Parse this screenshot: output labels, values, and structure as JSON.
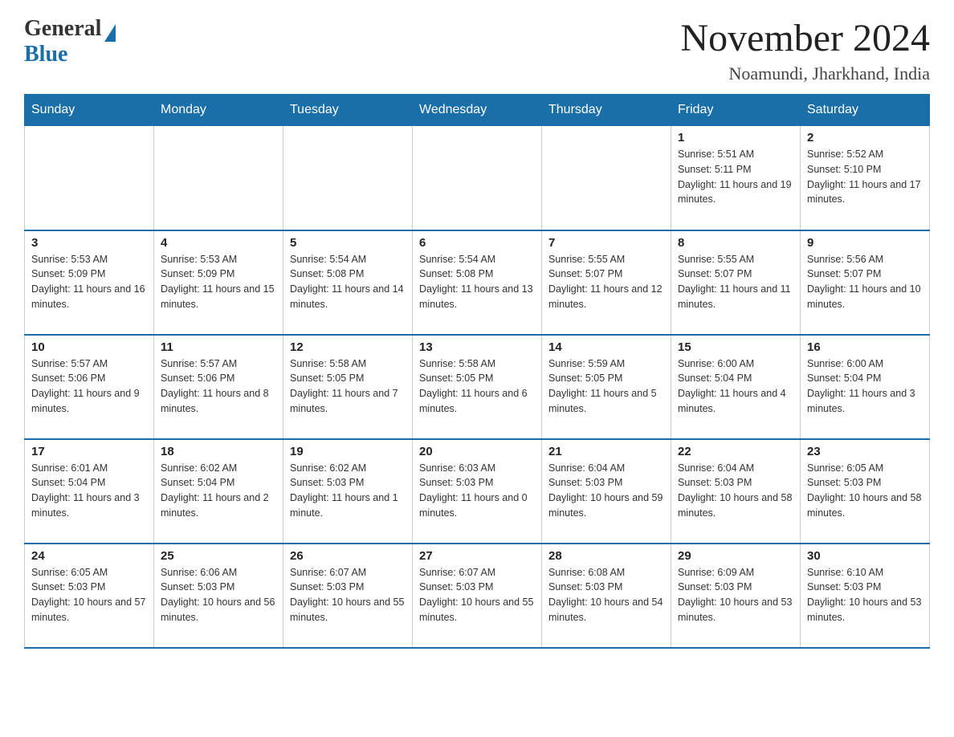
{
  "logo": {
    "general": "General",
    "blue": "Blue"
  },
  "title": "November 2024",
  "subtitle": "Noamundi, Jharkhand, India",
  "weekdays": [
    "Sunday",
    "Monday",
    "Tuesday",
    "Wednesday",
    "Thursday",
    "Friday",
    "Saturday"
  ],
  "weeks": [
    [
      {
        "day": "",
        "info": ""
      },
      {
        "day": "",
        "info": ""
      },
      {
        "day": "",
        "info": ""
      },
      {
        "day": "",
        "info": ""
      },
      {
        "day": "",
        "info": ""
      },
      {
        "day": "1",
        "info": "Sunrise: 5:51 AM\nSunset: 5:11 PM\nDaylight: 11 hours and 19 minutes."
      },
      {
        "day": "2",
        "info": "Sunrise: 5:52 AM\nSunset: 5:10 PM\nDaylight: 11 hours and 17 minutes."
      }
    ],
    [
      {
        "day": "3",
        "info": "Sunrise: 5:53 AM\nSunset: 5:09 PM\nDaylight: 11 hours and 16 minutes."
      },
      {
        "day": "4",
        "info": "Sunrise: 5:53 AM\nSunset: 5:09 PM\nDaylight: 11 hours and 15 minutes."
      },
      {
        "day": "5",
        "info": "Sunrise: 5:54 AM\nSunset: 5:08 PM\nDaylight: 11 hours and 14 minutes."
      },
      {
        "day": "6",
        "info": "Sunrise: 5:54 AM\nSunset: 5:08 PM\nDaylight: 11 hours and 13 minutes."
      },
      {
        "day": "7",
        "info": "Sunrise: 5:55 AM\nSunset: 5:07 PM\nDaylight: 11 hours and 12 minutes."
      },
      {
        "day": "8",
        "info": "Sunrise: 5:55 AM\nSunset: 5:07 PM\nDaylight: 11 hours and 11 minutes."
      },
      {
        "day": "9",
        "info": "Sunrise: 5:56 AM\nSunset: 5:07 PM\nDaylight: 11 hours and 10 minutes."
      }
    ],
    [
      {
        "day": "10",
        "info": "Sunrise: 5:57 AM\nSunset: 5:06 PM\nDaylight: 11 hours and 9 minutes."
      },
      {
        "day": "11",
        "info": "Sunrise: 5:57 AM\nSunset: 5:06 PM\nDaylight: 11 hours and 8 minutes."
      },
      {
        "day": "12",
        "info": "Sunrise: 5:58 AM\nSunset: 5:05 PM\nDaylight: 11 hours and 7 minutes."
      },
      {
        "day": "13",
        "info": "Sunrise: 5:58 AM\nSunset: 5:05 PM\nDaylight: 11 hours and 6 minutes."
      },
      {
        "day": "14",
        "info": "Sunrise: 5:59 AM\nSunset: 5:05 PM\nDaylight: 11 hours and 5 minutes."
      },
      {
        "day": "15",
        "info": "Sunrise: 6:00 AM\nSunset: 5:04 PM\nDaylight: 11 hours and 4 minutes."
      },
      {
        "day": "16",
        "info": "Sunrise: 6:00 AM\nSunset: 5:04 PM\nDaylight: 11 hours and 3 minutes."
      }
    ],
    [
      {
        "day": "17",
        "info": "Sunrise: 6:01 AM\nSunset: 5:04 PM\nDaylight: 11 hours and 3 minutes."
      },
      {
        "day": "18",
        "info": "Sunrise: 6:02 AM\nSunset: 5:04 PM\nDaylight: 11 hours and 2 minutes."
      },
      {
        "day": "19",
        "info": "Sunrise: 6:02 AM\nSunset: 5:03 PM\nDaylight: 11 hours and 1 minute."
      },
      {
        "day": "20",
        "info": "Sunrise: 6:03 AM\nSunset: 5:03 PM\nDaylight: 11 hours and 0 minutes."
      },
      {
        "day": "21",
        "info": "Sunrise: 6:04 AM\nSunset: 5:03 PM\nDaylight: 10 hours and 59 minutes."
      },
      {
        "day": "22",
        "info": "Sunrise: 6:04 AM\nSunset: 5:03 PM\nDaylight: 10 hours and 58 minutes."
      },
      {
        "day": "23",
        "info": "Sunrise: 6:05 AM\nSunset: 5:03 PM\nDaylight: 10 hours and 58 minutes."
      }
    ],
    [
      {
        "day": "24",
        "info": "Sunrise: 6:05 AM\nSunset: 5:03 PM\nDaylight: 10 hours and 57 minutes."
      },
      {
        "day": "25",
        "info": "Sunrise: 6:06 AM\nSunset: 5:03 PM\nDaylight: 10 hours and 56 minutes."
      },
      {
        "day": "26",
        "info": "Sunrise: 6:07 AM\nSunset: 5:03 PM\nDaylight: 10 hours and 55 minutes."
      },
      {
        "day": "27",
        "info": "Sunrise: 6:07 AM\nSunset: 5:03 PM\nDaylight: 10 hours and 55 minutes."
      },
      {
        "day": "28",
        "info": "Sunrise: 6:08 AM\nSunset: 5:03 PM\nDaylight: 10 hours and 54 minutes."
      },
      {
        "day": "29",
        "info": "Sunrise: 6:09 AM\nSunset: 5:03 PM\nDaylight: 10 hours and 53 minutes."
      },
      {
        "day": "30",
        "info": "Sunrise: 6:10 AM\nSunset: 5:03 PM\nDaylight: 10 hours and 53 minutes."
      }
    ]
  ]
}
